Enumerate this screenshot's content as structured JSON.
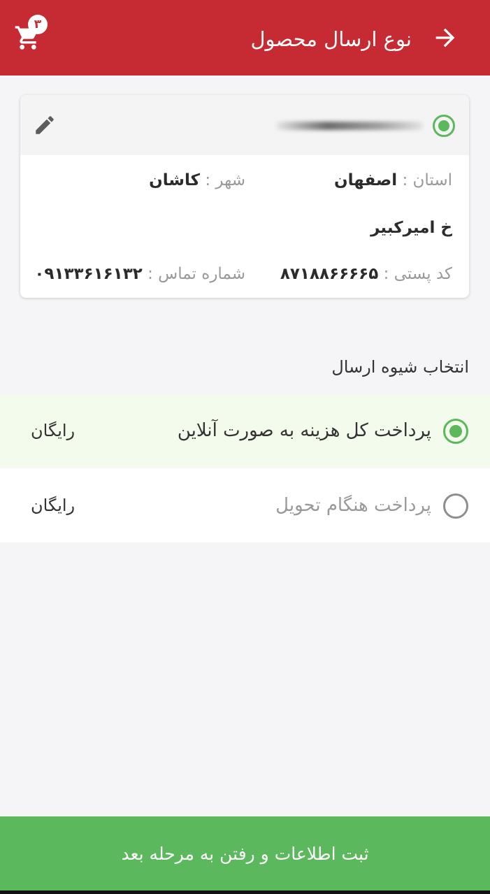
{
  "header": {
    "title": "نوع ارسال محصول",
    "cart_count": "۳",
    "back_icon": "arrow-right-icon",
    "cart_icon": "cart-icon"
  },
  "address": {
    "province_label": "استان :",
    "province_value": "اصفهان",
    "city_label": "شهر :",
    "city_value": "کاشان",
    "street": "خ امیرکبیر",
    "postal_label": "کد پستی :",
    "postal_value": "۸۷۱۸۸۶۶۶۶۵",
    "phone_label": "شماره تماس :",
    "phone_value": "۰۹۱۳۳۶۱۶۱۳۲"
  },
  "shipping": {
    "title": "انتخاب شیوه ارسال",
    "options": [
      {
        "label": "پرداخت کل هزینه به صورت آنلاین",
        "price": "رایگان",
        "selected": true
      },
      {
        "label": "پرداخت هنگام تحویل",
        "price": "رایگان",
        "selected": false
      }
    ]
  },
  "submit_label": "ثبت اطلاعات و رفتن به مرحله بعد",
  "colors": {
    "appbar": "#c62a33",
    "accent_green": "#5cb85c",
    "background": "#f5f4f6"
  }
}
